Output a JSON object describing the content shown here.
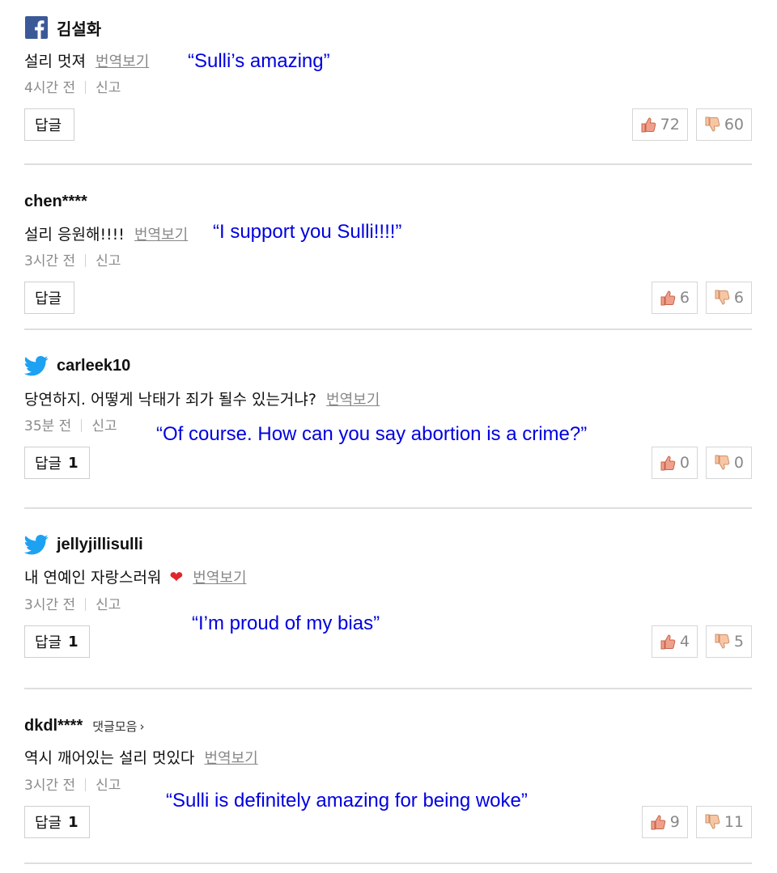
{
  "translate_label": "번역보기",
  "report_label": "신고",
  "reply_label": "답글",
  "comments": [
    {
      "nickname": "김설화",
      "sns": "facebook",
      "text": "설리 멋져",
      "time": "4시간 전",
      "reply_count": "",
      "likes": "72",
      "dislikes": "60",
      "translation": "“Sulli’s amazing”"
    },
    {
      "nickname": "chen****",
      "sns": "none",
      "text": "설리 응원해!!!!",
      "time": "3시간 전",
      "reply_count": "",
      "likes": "6",
      "dislikes": "6",
      "translation": "“I support you Sulli!!!!”"
    },
    {
      "nickname": "carleek10",
      "sns": "twitter",
      "text": "당연하지. 어떻게 낙태가 죄가 될수 있는거냐?",
      "time": "35분 전",
      "reply_count": "1",
      "likes": "0",
      "dislikes": "0",
      "translation": "“Of course. How can you say abortion is a crime?”"
    },
    {
      "nickname": "jellyjillisulli",
      "sns": "twitter",
      "text": "내 연예인 자랑스러워",
      "emoji": "❤",
      "time": "3시간 전",
      "reply_count": "1",
      "likes": "4",
      "dislikes": "5",
      "translation": "“I’m proud of my bias”"
    },
    {
      "nickname": "dkdl****",
      "sns": "none",
      "more_label": "댓글모음",
      "text": "역시 깨어있는 설리 멋있다",
      "time": "3시간 전",
      "reply_count": "1",
      "likes": "9",
      "dislikes": "11",
      "translation": "“Sulli is definitely amazing for being woke”"
    }
  ],
  "colors": {
    "translation": "#0000e0",
    "facebook": "#3b5998",
    "twitter": "#1da1f2",
    "heart": "#e0252b"
  }
}
